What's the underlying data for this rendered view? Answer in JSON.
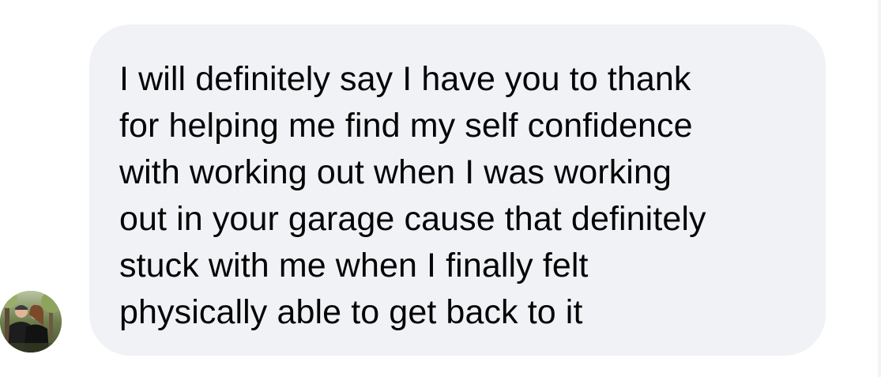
{
  "conversation": {
    "message": {
      "text": "I will definitely say I have you to thank\nfor helping me find my self confidence\nwith working out when I was working\nout in your garage cause that definitely\nstuck with me when I finally felt\nphysically able to get back to it"
    },
    "sender": {
      "avatar_icon": "profile-photo"
    },
    "colors": {
      "bubble_background": "#f0f2f5",
      "text": "#050505",
      "page_background": "#ffffff"
    }
  }
}
